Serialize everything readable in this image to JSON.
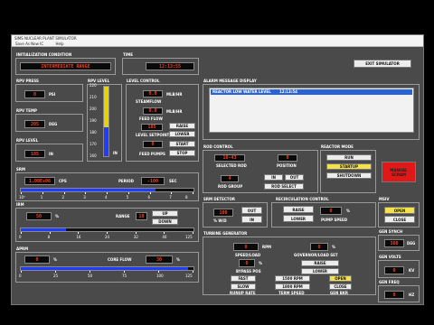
{
  "window": {
    "title": "SIMS NUCLEAR PLANT SIMULATOR",
    "menu": [
      "Save As New IC",
      "Help"
    ]
  },
  "init": {
    "title": "INITIALIZATION CONDITION",
    "value": "INTERMEDIATE RANGE"
  },
  "time": {
    "title": "TIME",
    "value": "12:13:55"
  },
  "exit": {
    "label": "EXIT SIMULATOR"
  },
  "rpv_press": {
    "title": "RPV PRESS",
    "value": "0",
    "unit": "PSI"
  },
  "rpv_temp": {
    "title": "RPV TEMP",
    "value": "205",
    "unit": "DEG"
  },
  "rpv_level_panel": {
    "title": "RPV LEVEL",
    "value": "185",
    "unit": "IN"
  },
  "rpv_level_bar": {
    "title": "RPV LEVEL",
    "ticks": [
      "220",
      "210",
      "200",
      "190",
      "180",
      "170",
      "160"
    ],
    "unit": "IN",
    "level": 0.42,
    "yellow_level": 0.58
  },
  "level_control": {
    "title": "LEVEL CONTROL",
    "steamflow_value": "0.0",
    "steamflow_unit": "MLB/HR",
    "steamflow_label": "STEAMFLOW",
    "feedflow_value": "0.0",
    "feedflow_unit": "MLB/HR",
    "feedflow_label": "FEED FLOW",
    "setpoint_value": "185",
    "setpoint_label": "LEVEL SETPOINT",
    "raise": "RAISE",
    "lower": "LOWER",
    "pumps_value": "0",
    "pumps_label": "FEED PUMPS",
    "start": "START",
    "stop": "STOP"
  },
  "alarm": {
    "title": "ALARM MESSAGE DISPLAY",
    "rows": [
      {
        "message": "REACTOR LOW WATER LEVEL",
        "time": "12:13:54"
      }
    ]
  },
  "rod_control": {
    "title": "ROD CONTROL",
    "selected_value": "10-43",
    "selected_label": "SELECTED ROD",
    "position_value": "0",
    "position_label": "POSITION",
    "group_value": "4",
    "group_label": "ROD GROUP",
    "in_label": "IN",
    "out_label": "OUT",
    "rod_select": "ROD SELECT"
  },
  "reactor_mode": {
    "title": "REACTOR MODE",
    "run": "RUN",
    "startup": "STARTUP",
    "shutdown": "SHUTDOWN",
    "scram": "MANUAL SCRAM"
  },
  "srm": {
    "title": "SRM",
    "value": "1.00E+06",
    "unit": "CPS",
    "period_label": "PERIOD",
    "period_value": "-100",
    "period_unit": "SEC",
    "ticks": [
      "10⁰",
      "1",
      "2",
      "3",
      "4",
      "5",
      "6",
      "7",
      "8"
    ],
    "level": 0.78
  },
  "srm_detector": {
    "title": "SRM DETECTOR",
    "value": "100",
    "unit": "% W/D",
    "out": "OUT",
    "in": "IN"
  },
  "recirc": {
    "title": "RECIRCULATION CONTROL",
    "raise": "RAISE",
    "lower": "LOWER",
    "value": "0",
    "unit": "%",
    "label": "PUMP SPEED"
  },
  "msiv": {
    "title": "MSIV",
    "open": "OPEN",
    "close": "CLOSE"
  },
  "irm": {
    "title": "IRM",
    "value": "50",
    "unit": "%",
    "range_label": "RANGE",
    "range_value": "10",
    "up": "UP",
    "down": "DOWN",
    "ticks": [
      "0",
      "8",
      "16",
      "24",
      "32",
      "40",
      "125"
    ],
    "level": 0.26
  },
  "turbine": {
    "title": "TURBINE GENERATOR",
    "speed_value": "0",
    "speed_unit": "RPM",
    "speed_label": "SPEED/LOAD",
    "gov_value": "0",
    "gov_unit": "%",
    "gov_label": "GOVERNOR/LOAD SET",
    "bypass_value": "0",
    "bypass_unit": "%",
    "bypass_label": "BYPASS POS",
    "raise": "RAISE",
    "lower": "LOWER",
    "fast": "FAST",
    "slow": "SLOW",
    "runup_label": "RUNUP RATE",
    "rpm1500": "1500 RPM",
    "rpm1800": "1800 RPM",
    "term_label": "TERM SPEED",
    "open": "OPEN",
    "close": "CLOSE",
    "bkr_label": "GEN BKR"
  },
  "gen_synch": {
    "title": "GEN SYNCH",
    "value": "360",
    "unit": "DEG"
  },
  "gen_volts": {
    "title": "GEN VOLTS",
    "value": "0",
    "unit": "KV"
  },
  "gen_freq": {
    "title": "GEN FREQ",
    "value": "0",
    "unit": "HZ"
  },
  "aprm": {
    "title": "APRM",
    "value": "0",
    "unit": "%",
    "core_flow_label": "CORE FLOW",
    "core_flow_value": "30",
    "core_flow_unit": "%",
    "ticks": [
      "0",
      "25",
      "50",
      "75",
      "100",
      "125"
    ],
    "level": 0.97
  },
  "colors": {
    "display_text": "#ff3a1f",
    "bar_fill": "#1f3cff",
    "level_yellow": "#e8d200",
    "alarm_highlight": "#2a63d8",
    "scram": "#e01818",
    "active_button": "#f5e24a"
  }
}
